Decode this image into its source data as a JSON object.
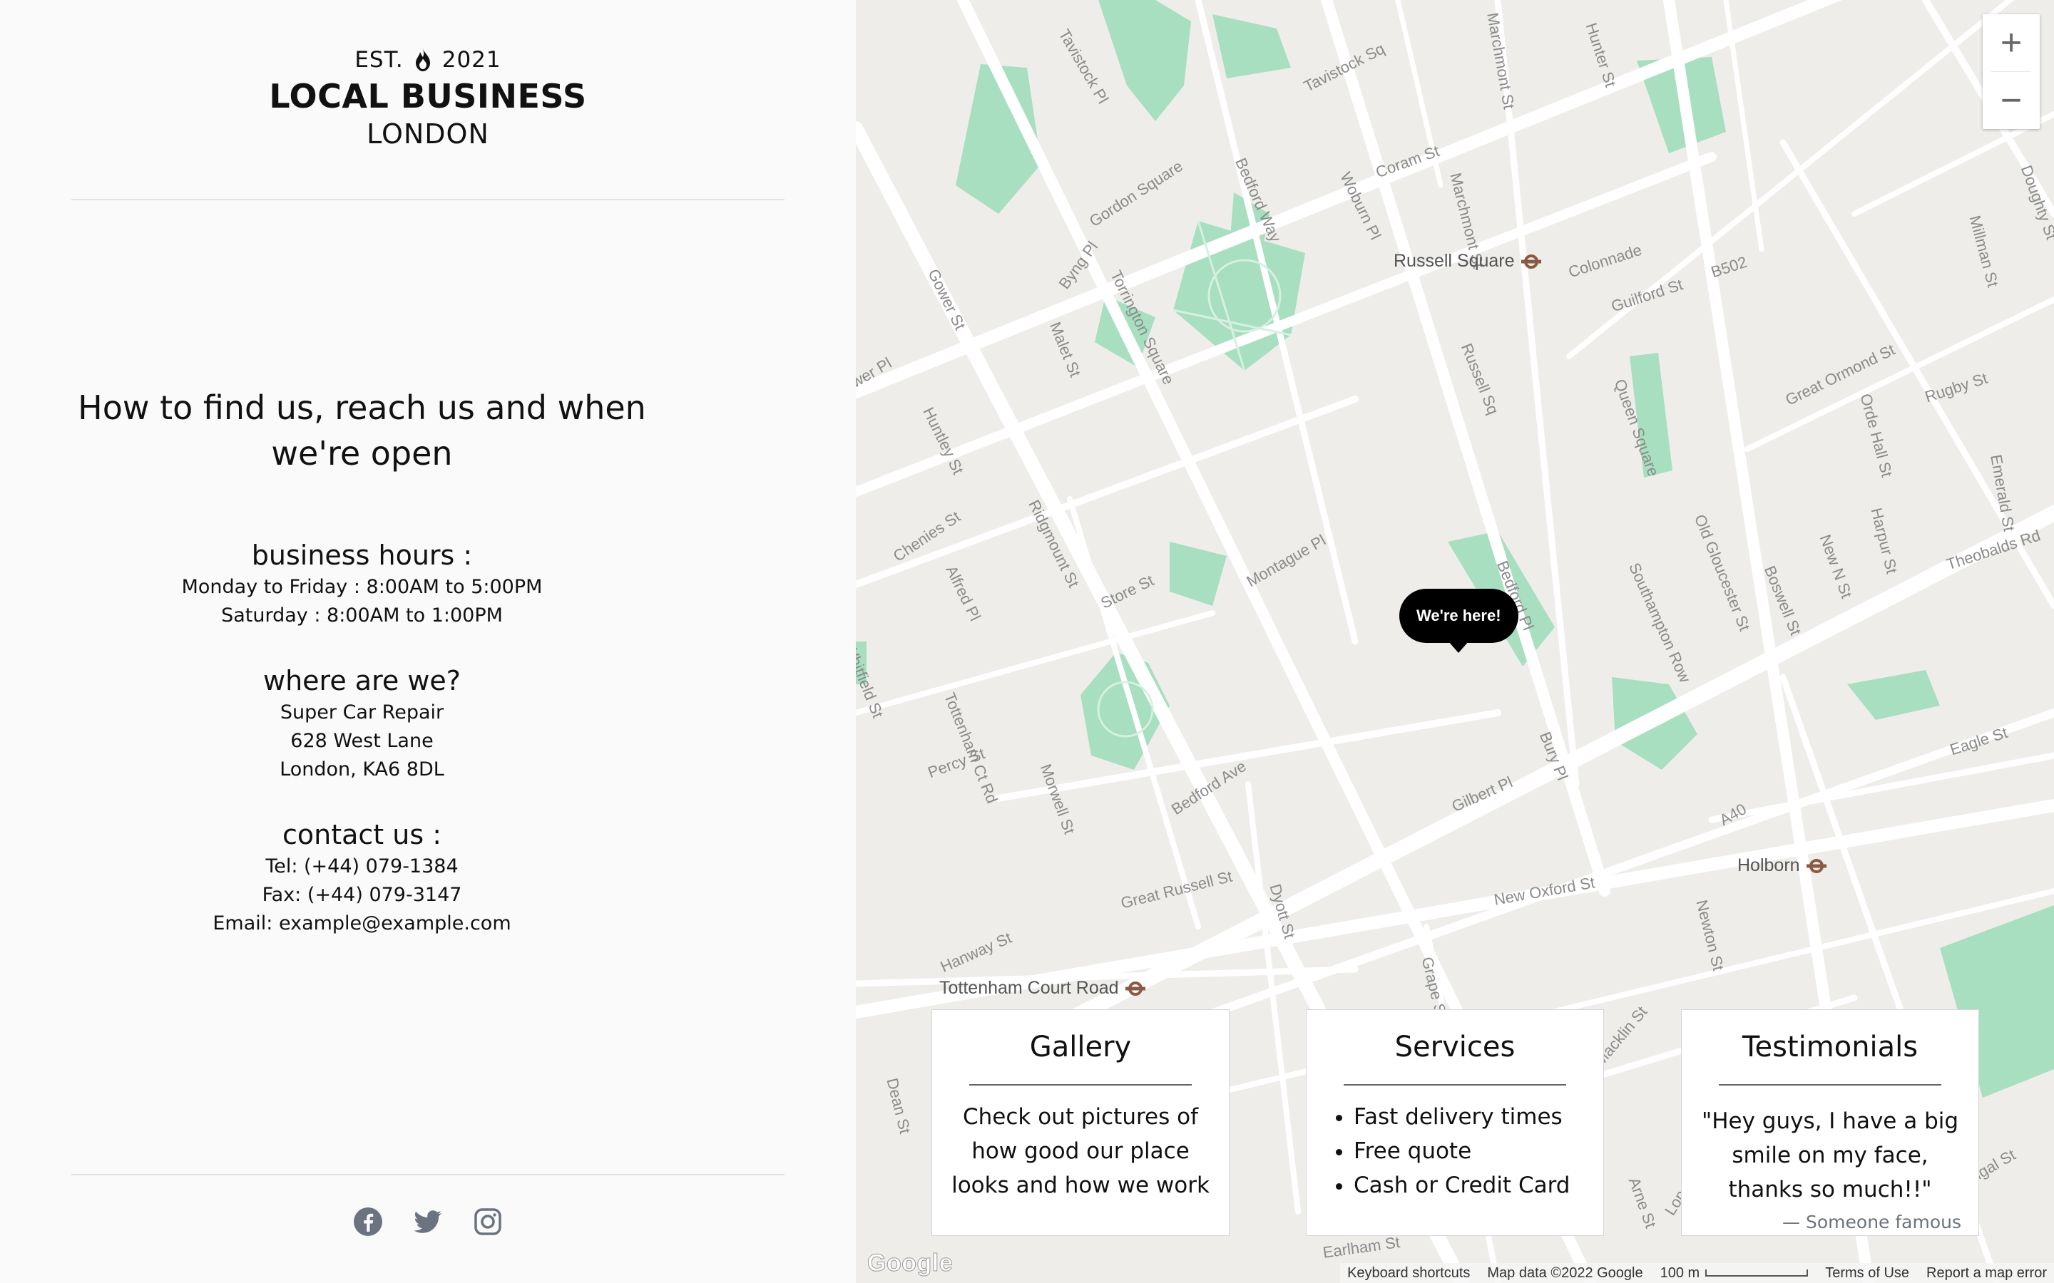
{
  "brand": {
    "est_label": "EST.",
    "est_year": "2021",
    "name": "LOCAL BUSINESS",
    "city": "LONDON"
  },
  "heading": "How to find us, reach us and when we're open",
  "hours": {
    "title": "business hours :",
    "lines": [
      "Monday to Friday : 8:00AM to 5:00PM",
      "Saturday : 8:00AM to 1:00PM"
    ]
  },
  "where": {
    "title": "where are we?",
    "lines": [
      "Super Car Repair",
      "628 West Lane",
      "London, KA6 8DL"
    ]
  },
  "contact": {
    "title": "contact us :",
    "lines": [
      "Tel: (+44) 079-1384",
      "Fax: (+44) 079-3147",
      "Email: example@example.com"
    ]
  },
  "social": [
    "facebook-icon",
    "twitter-icon",
    "instagram-icon"
  ],
  "map": {
    "marker_label": "We're here!",
    "zoom_in": "+",
    "zoom_out": "−",
    "stations": [
      "Russell Square",
      "Holborn",
      "Tottenham Court Road"
    ],
    "streets": [
      "Tavistock Pl",
      "Tavistock Sq",
      "Gordon Square",
      "Woburn Pl",
      "Coram St",
      "Marchmont St",
      "Bedford Way",
      "Byng Pl",
      "Gower St",
      "Torrington Square",
      "Malet St",
      "Colonnade",
      "Guilford St",
      "B502",
      "Russell Sq",
      "Queen Square",
      "Great Ormond St",
      "Rugby St",
      "Orde Hall St",
      "Millman St",
      "Huntley St",
      "Chenies St",
      "Alfred Pl",
      "Ridgmount St",
      "Store St",
      "Montague Pl",
      "Bedford Pl",
      "Southampton Row",
      "Old Gloucester St",
      "Boswell St",
      "New N St",
      "Harpur St",
      "Emerald St",
      "Theobalds Rd",
      "A40",
      "Eagle St",
      "Whitfield St",
      "Tottenham Ct Rd",
      "Percy St",
      "Morwell St",
      "Bedford Ave",
      "Gilbert Pl",
      "Bury Pl",
      "Great Russell St",
      "Dyott St",
      "New Oxford St",
      "Newton St",
      "Hanway St",
      "Grape St",
      "Macklin St",
      "Dean St",
      "Earlham St",
      "Arne St",
      "Long Acre",
      "Portugal St",
      "Doughty St",
      "Gower Pl",
      "Marchmont St",
      "Hunter St"
    ],
    "attribution": {
      "shortcuts": "Keyboard shortcuts",
      "data": "Map data ©2022 Google",
      "scale": "100 m",
      "terms": "Terms of Use",
      "report": "Report a map error"
    },
    "logo": "Google",
    "colors": {
      "land": "#eeedea",
      "park": "#a8dfc0",
      "road": "#ffffff"
    }
  },
  "cards": {
    "gallery": {
      "title": "Gallery",
      "text": "Check out pictures of how good our place looks and how we work"
    },
    "services": {
      "title": "Services",
      "items": [
        "Fast delivery times",
        "Free quote",
        "Cash or Credit Card"
      ]
    },
    "testimonials": {
      "title": "Testimonials",
      "quote": "\"Hey guys, I have a big smile on my face, thanks so much!!\"",
      "cite": "— Someone famous"
    }
  }
}
